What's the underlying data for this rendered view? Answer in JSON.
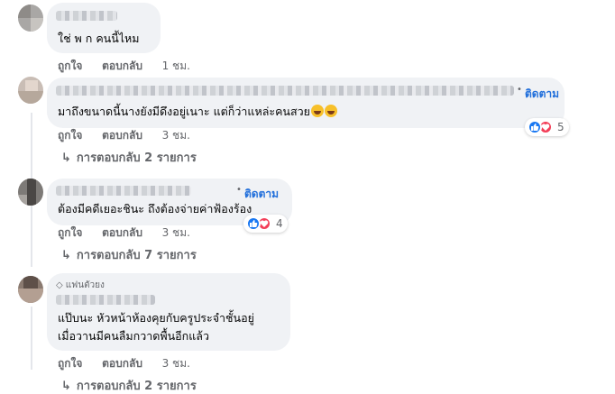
{
  "actions": {
    "like": "ถูกใจ",
    "reply": "ตอบกลับ"
  },
  "comments": [
    {
      "text": "ใช่ พ ก คนนี้ไหม",
      "time": "1 ชม."
    },
    {
      "text": "มาถึงขนาดนี้นางยังมีดึงอยู่เนาะ แต่ก็ว่าแหล่ะคนสวย",
      "emoji": [
        "laughing-crying-emoji",
        "laughing-crying-emoji"
      ],
      "time": "3 ชม.",
      "follow": "ติดตาม",
      "reaction_count": "5",
      "replies": "การตอบกลับ 2 รายการ"
    },
    {
      "text": "ต้องมีคดีเยอะชินะ ถึงต้องจ่ายค่าฟ้องร้อง",
      "time": "3 ชม.",
      "follow": "ติดตาม",
      "reaction_count": "4",
      "replies": "การตอบกลับ 7 รายการ"
    },
    {
      "badge": "แฟนตัวยง",
      "text_line1": "แป๊บนะ หัวหน้าห้องคุยกับครูประจำชั้นอยู่",
      "text_line2": "เมื่อวานมีคนลืมกวาดพื้นอีกแล้ว",
      "time": "3 ชม.",
      "replies": "การตอบกลับ 2 รายการ"
    }
  ],
  "icons": {
    "like": "like-reaction-icon",
    "love": "love-reaction-icon",
    "reply_arrow": "reply-arrow-icon",
    "badge": "diamond-icon"
  },
  "colors": {
    "link": "#216fdb",
    "bubble": "#f0f2f5",
    "muted": "#65676b",
    "like": "#1877f2",
    "love": "#f33e58"
  }
}
